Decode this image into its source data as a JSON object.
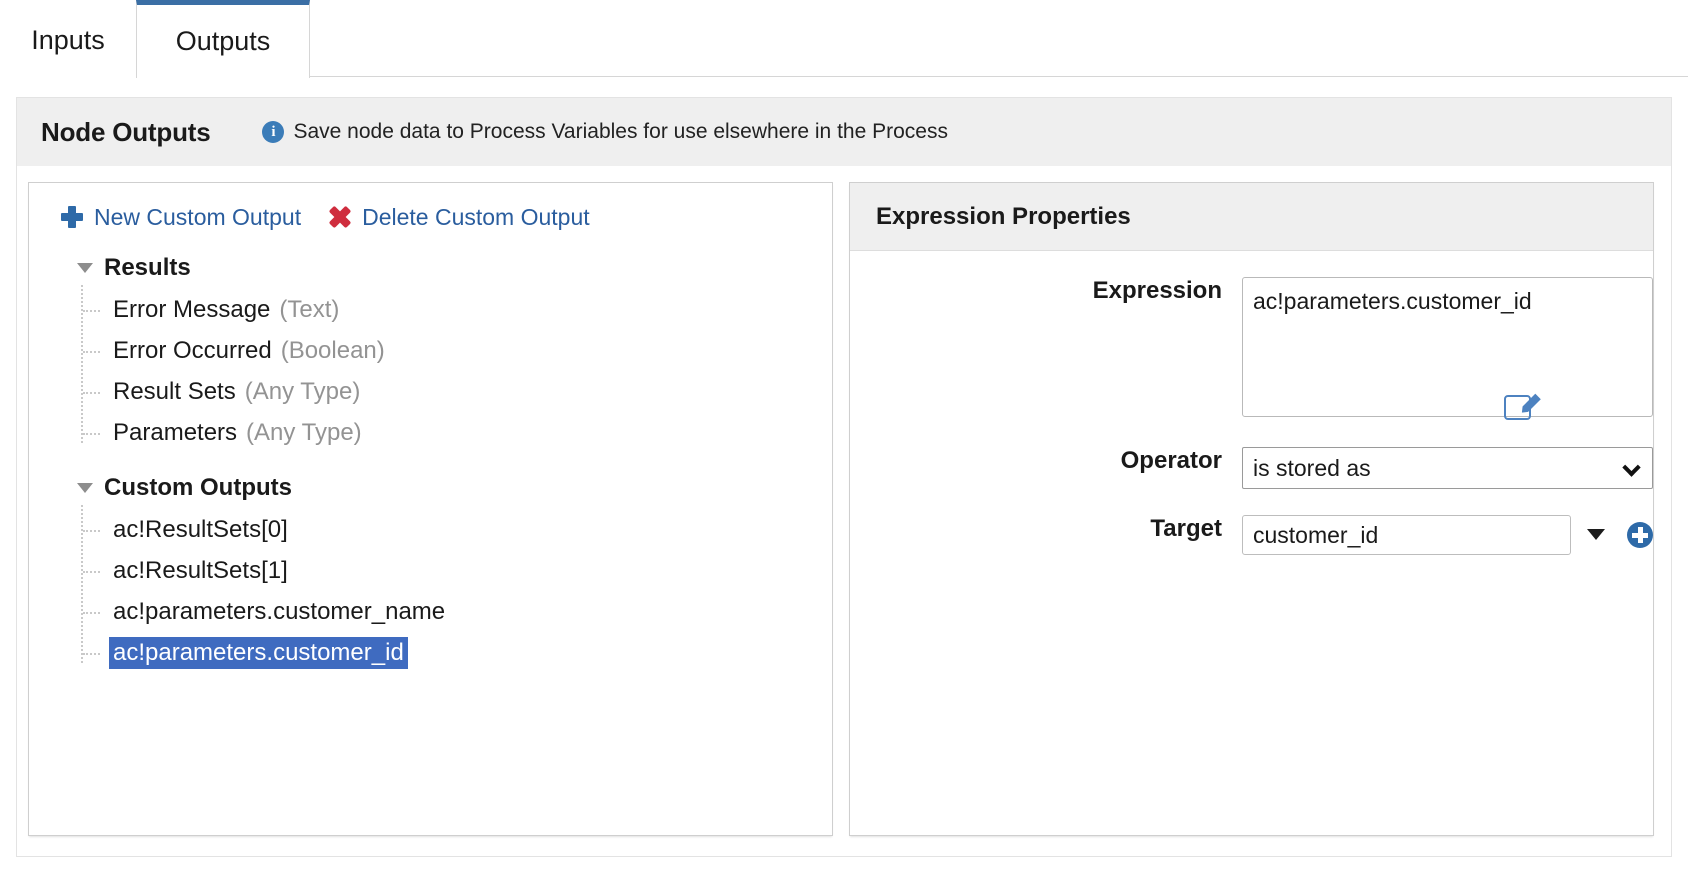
{
  "tabs": [
    {
      "label": "Inputs",
      "active": false
    },
    {
      "label": "Outputs",
      "active": true
    }
  ],
  "section": {
    "title": "Node Outputs",
    "hint": "Save node data to Process Variables for use elsewhere in the Process",
    "info_icon": "info-icon"
  },
  "left_panel": {
    "toolbar": {
      "new_label": "New Custom Output",
      "new_icon": "plus-icon",
      "delete_label": "Delete Custom Output",
      "delete_icon": "x-icon"
    },
    "tree": {
      "groups": [
        {
          "label": "Results",
          "expanded": true,
          "items": [
            {
              "name": "Error Message",
              "type": "(Text)",
              "selected": false
            },
            {
              "name": "Error Occurred",
              "type": "(Boolean)",
              "selected": false
            },
            {
              "name": "Result Sets",
              "type": "(Any Type)",
              "selected": false
            },
            {
              "name": "Parameters",
              "type": "(Any Type)",
              "selected": false
            }
          ]
        },
        {
          "label": "Custom Outputs",
          "expanded": true,
          "items": [
            {
              "name": "ac!ResultSets[0]",
              "type": "",
              "selected": false
            },
            {
              "name": "ac!ResultSets[1]",
              "type": "",
              "selected": false
            },
            {
              "name": "ac!parameters.customer_name",
              "type": "",
              "selected": false
            },
            {
              "name": "ac!parameters.customer_id",
              "type": "",
              "selected": true
            }
          ]
        }
      ]
    }
  },
  "right_panel": {
    "title": "Expression Properties",
    "expression": {
      "label": "Expression",
      "value": "ac!parameters.customer_id",
      "edit_icon": "edit-pencil-icon"
    },
    "operator": {
      "label": "Operator",
      "value": "is stored as",
      "options": [
        "is stored as"
      ]
    },
    "target": {
      "label": "Target",
      "value": "customer_id",
      "dropdown_icon": "chevron-down-icon",
      "add_icon": "circle-plus-icon"
    }
  },
  "colors": {
    "accent_blue": "#2e6aa8",
    "tab_active_top": "#3b6fa5",
    "selection_blue": "#3f6bc0",
    "delete_red": "#cf2d3e",
    "header_grey": "#efefef"
  }
}
